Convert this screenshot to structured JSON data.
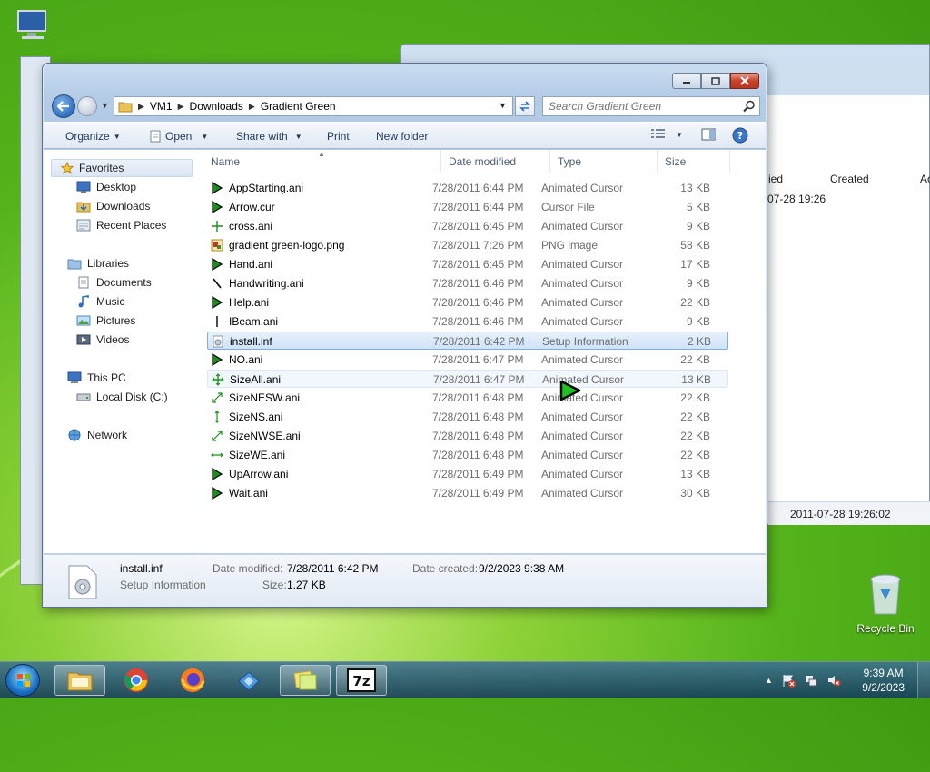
{
  "desktop": {
    "recycle_bin_label": "Recycle Bin"
  },
  "background_window": {
    "col_modified": "ied",
    "col_created": "Created",
    "col_more": "Ac",
    "cell_modified": "07-28 19:26",
    "bottom_value": "2011-07-28 19:26:02"
  },
  "window": {
    "breadcrumbs": [
      "VM1",
      "Downloads",
      "Gradient Green"
    ],
    "search_placeholder": "Search Gradient Green",
    "toolbar": {
      "organize": "Organize",
      "open": "Open",
      "share_with": "Share with",
      "print": "Print",
      "new_folder": "New folder"
    },
    "nav": {
      "favorites": "Favorites",
      "desktop": "Desktop",
      "downloads": "Downloads",
      "recent_places": "Recent Places",
      "libraries": "Libraries",
      "documents": "Documents",
      "music": "Music",
      "pictures": "Pictures",
      "videos": "Videos",
      "this_pc": "This PC",
      "local_disk": "Local Disk (C:)",
      "network": "Network"
    },
    "columns": {
      "name": "Name",
      "date_modified": "Date modified",
      "type": "Type",
      "size": "Size"
    },
    "files": [
      {
        "name": "AppStarting.ani",
        "date": "7/28/2011 6:44 PM",
        "type": "Animated Cursor",
        "size": "13 KB",
        "icon": "cursor-arrow-icon"
      },
      {
        "name": "Arrow.cur",
        "date": "7/28/2011 6:44 PM",
        "type": "Cursor File",
        "size": "5 KB",
        "icon": "cursor-arrow-icon"
      },
      {
        "name": "cross.ani",
        "date": "7/28/2011 6:45 PM",
        "type": "Animated Cursor",
        "size": "9 KB",
        "icon": "crosshair-icon"
      },
      {
        "name": "gradient green-logo.png",
        "date": "7/28/2011 7:26 PM",
        "type": "PNG image",
        "size": "58 KB",
        "icon": "image-file-icon"
      },
      {
        "name": "Hand.ani",
        "date": "7/28/2011 6:45 PM",
        "type": "Animated Cursor",
        "size": "17 KB",
        "icon": "cursor-arrow-icon"
      },
      {
        "name": "Handwriting.ani",
        "date": "7/28/2011 6:46 PM",
        "type": "Animated Cursor",
        "size": "9 KB",
        "icon": "pen-cursor-icon"
      },
      {
        "name": "Help.ani",
        "date": "7/28/2011 6:46 PM",
        "type": "Animated Cursor",
        "size": "22 KB",
        "icon": "cursor-arrow-icon"
      },
      {
        "name": "IBeam.ani",
        "date": "7/28/2011 6:46 PM",
        "type": "Animated Cursor",
        "size": "9 KB",
        "icon": "ibeam-icon"
      },
      {
        "name": "install.inf",
        "date": "7/28/2011 6:42 PM",
        "type": "Setup Information",
        "size": "2 KB",
        "icon": "setup-file-icon"
      },
      {
        "name": "NO.ani",
        "date": "7/28/2011 6:47 PM",
        "type": "Animated Cursor",
        "size": "22 KB",
        "icon": "cursor-arrow-icon"
      },
      {
        "name": "SizeAll.ani",
        "date": "7/28/2011 6:47 PM",
        "type": "Animated Cursor",
        "size": "13 KB",
        "icon": "move-icon"
      },
      {
        "name": "SizeNESW.ani",
        "date": "7/28/2011 6:48 PM",
        "type": "Animated Cursor",
        "size": "22 KB",
        "icon": "resize-diagonal-icon"
      },
      {
        "name": "SizeNS.ani",
        "date": "7/28/2011 6:48 PM",
        "type": "Animated Cursor",
        "size": "22 KB",
        "icon": "resize-vertical-icon"
      },
      {
        "name": "SizeNWSE.ani",
        "date": "7/28/2011 6:48 PM",
        "type": "Animated Cursor",
        "size": "22 KB",
        "icon": "resize-diagonal-icon"
      },
      {
        "name": "SizeWE.ani",
        "date": "7/28/2011 6:48 PM",
        "type": "Animated Cursor",
        "size": "22 KB",
        "icon": "resize-horizontal-icon"
      },
      {
        "name": "UpArrow.ani",
        "date": "7/28/2011 6:49 PM",
        "type": "Animated Cursor",
        "size": "13 KB",
        "icon": "cursor-arrow-icon"
      },
      {
        "name": "Wait.ani",
        "date": "7/28/2011 6:49 PM",
        "type": "Animated Cursor",
        "size": "30 KB",
        "icon": "cursor-arrow-icon"
      }
    ],
    "details": {
      "name": "install.inf",
      "type": "Setup Information",
      "modified_label": "Date modified:",
      "modified_value": "7/28/2011 6:42 PM",
      "created_label": "Date created:",
      "created_value": "9/2/2023 9:38 AM",
      "size_label": "Size:",
      "size_value": "1.27 KB"
    }
  },
  "taskbar": {
    "time": "9:39 AM",
    "date": "9/2/2023"
  },
  "colors": {
    "accent": "#2f6fc0",
    "selection": "#cfe3f8",
    "cursor_green": "#1fc21f"
  }
}
